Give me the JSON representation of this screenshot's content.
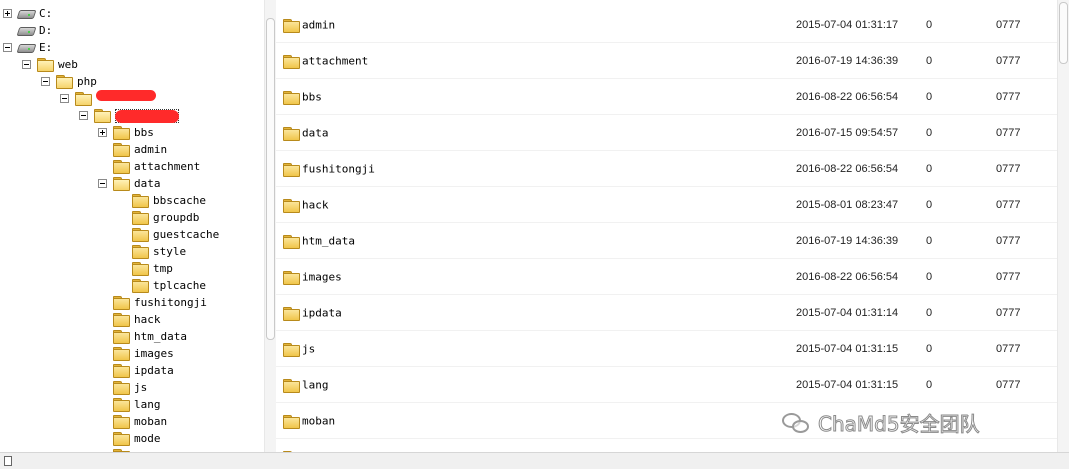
{
  "tree": {
    "nodes": [
      {
        "label": "C:",
        "icon": "drive-icon",
        "expander": "plus"
      },
      {
        "label": "D:",
        "icon": "drive-icon",
        "expander": "none"
      },
      {
        "label": "E:",
        "icon": "drive-icon",
        "expander": "minus"
      },
      {
        "label": "web",
        "icon": "folder-open-icon",
        "expander": "minus"
      },
      {
        "label": "php",
        "icon": "folder-open-icon",
        "expander": "minus"
      },
      {
        "label": "",
        "icon": "folder-open-icon",
        "expander": "minus",
        "redacted": true
      },
      {
        "label": "",
        "icon": "folder-open-icon",
        "expander": "minus",
        "redacted": true,
        "selected": true
      },
      {
        "label": "bbs",
        "icon": "folder-icon",
        "expander": "plus"
      },
      {
        "label": "admin",
        "icon": "folder-icon",
        "expander": "none"
      },
      {
        "label": "attachment",
        "icon": "folder-icon",
        "expander": "none"
      },
      {
        "label": "data",
        "icon": "folder-open-icon",
        "expander": "minus"
      },
      {
        "label": "bbscache",
        "icon": "folder-icon",
        "expander": "none"
      },
      {
        "label": "groupdb",
        "icon": "folder-icon",
        "expander": "none"
      },
      {
        "label": "guestcache",
        "icon": "folder-icon",
        "expander": "none"
      },
      {
        "label": "style",
        "icon": "folder-icon",
        "expander": "none"
      },
      {
        "label": "tmp",
        "icon": "folder-icon",
        "expander": "none"
      },
      {
        "label": "tplcache",
        "icon": "folder-icon",
        "expander": "none"
      },
      {
        "label": "fushitongji",
        "icon": "folder-icon",
        "expander": "none"
      },
      {
        "label": "hack",
        "icon": "folder-icon",
        "expander": "none"
      },
      {
        "label": "htm_data",
        "icon": "folder-icon",
        "expander": "none"
      },
      {
        "label": "images",
        "icon": "folder-icon",
        "expander": "none"
      },
      {
        "label": "ipdata",
        "icon": "folder-icon",
        "expander": "none"
      },
      {
        "label": "js",
        "icon": "folder-icon",
        "expander": "none"
      },
      {
        "label": "lang",
        "icon": "folder-icon",
        "expander": "none"
      },
      {
        "label": "moban",
        "icon": "folder-icon",
        "expander": "none"
      },
      {
        "label": "mode",
        "icon": "folder-icon",
        "expander": "none"
      },
      {
        "label": "",
        "icon": "folder-icon",
        "expander": "none"
      }
    ]
  },
  "files": [
    {
      "name": "admin",
      "time": "2015-07-04 01:31:17",
      "size": "0",
      "perm": "0777"
    },
    {
      "name": "attachment",
      "time": "2016-07-19 14:36:39",
      "size": "0",
      "perm": "0777"
    },
    {
      "name": "bbs",
      "time": "2016-08-22 06:56:54",
      "size": "0",
      "perm": "0777"
    },
    {
      "name": "data",
      "time": "2016-07-15 09:54:57",
      "size": "0",
      "perm": "0777"
    },
    {
      "name": "fushitongji",
      "time": "2016-08-22 06:56:54",
      "size": "0",
      "perm": "0777"
    },
    {
      "name": "hack",
      "time": "2015-08-01 08:23:47",
      "size": "0",
      "perm": "0777"
    },
    {
      "name": "htm_data",
      "time": "2016-07-19 14:36:39",
      "size": "0",
      "perm": "0777"
    },
    {
      "name": "images",
      "time": "2016-08-22 06:56:54",
      "size": "0",
      "perm": "0777"
    },
    {
      "name": "ipdata",
      "time": "2015-07-04 01:31:14",
      "size": "0",
      "perm": "0777"
    },
    {
      "name": "js",
      "time": "2015-07-04 01:31:15",
      "size": "0",
      "perm": "0777"
    },
    {
      "name": "lang",
      "time": "2015-07-04 01:31:15",
      "size": "0",
      "perm": "0777"
    },
    {
      "name": "moban",
      "time": "",
      "size": "",
      "perm": ""
    },
    {
      "name": "",
      "time": "",
      "size": "",
      "perm": ""
    }
  ],
  "watermark": {
    "text": "ChaMd5安全团队",
    "icon": "wechat-icon"
  },
  "colors": {
    "folder": "#f0c54a",
    "redaction": "#ff2a2a"
  }
}
